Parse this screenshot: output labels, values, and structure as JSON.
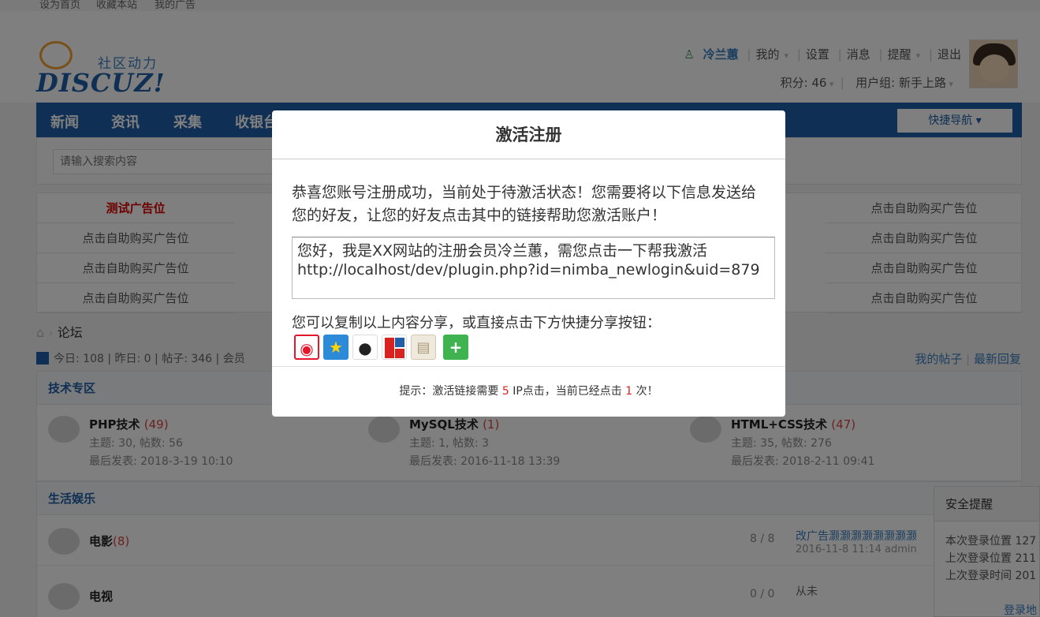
{
  "topbar": {
    "links": [
      "设为首页",
      "收藏本站",
      "我的广告"
    ]
  },
  "logo": {
    "slogan": "社区动力",
    "brand": "DISCUZ!"
  },
  "user": {
    "name": "冷兰蕙",
    "links": [
      "我的",
      "设置",
      "消息",
      "提醒",
      "退出"
    ],
    "points": "积分: 46",
    "group": "用户组: 新手上路"
  },
  "nav": {
    "items": [
      "新闻",
      "资讯",
      "采集",
      "收银台"
    ],
    "quick_nav": "快捷导航 ▾"
  },
  "search": {
    "placeholder": "请输入搜索内容"
  },
  "ads": {
    "test_ad": "测试广告位",
    "buy_ad": "点击自助购买广告位"
  },
  "breadcrumb": {
    "home_icon": "home-icon",
    "forum": "论坛"
  },
  "stats": {
    "text": "今日: 108 | 昨日: 0 | 帖子: 346 | 会员"
  },
  "mylinks": {
    "my_posts": "我的帖子",
    "latest": "最新回复"
  },
  "tech_section": {
    "title": "技术专区",
    "forums": [
      {
        "name": "PHP技术",
        "count": "(49)",
        "stats": "主题: 30, 帖数: 56",
        "last": "最后发表: 2018-3-19 10:10"
      },
      {
        "name": "MySQL技术",
        "count": "(1)",
        "stats": "主题: 1, 帖数: 3",
        "last": "最后发表: 2016-11-18 13:39"
      },
      {
        "name": "HTML+CSS技术",
        "count": "(47)",
        "stats": "主题: 35, 帖数: 276",
        "last": "最后发表: 2018-2-11 09:41"
      }
    ]
  },
  "life_section": {
    "title": "生活娱乐",
    "forums": [
      {
        "name": "电影",
        "count": "(8)",
        "ratio": "8 / 8",
        "last_title": "改广告灏灏灏灏灏灏灏灏",
        "last_meta": "2016-11-8 11:14 admin"
      },
      {
        "name": "电视",
        "count": "",
        "ratio": "0 / 0",
        "last_title": "从未",
        "last_meta": ""
      }
    ]
  },
  "security": {
    "title": "安全提醒",
    "lines": [
      "本次登录位置 127",
      "上次登录位置 211",
      "上次登录时间 201"
    ],
    "link": "登录地"
  },
  "modal": {
    "title": "激活注册",
    "message": "恭喜您账号注册成功，当前处于待激活状态！您需要将以下信息发送给您的好友，让您的好友点击其中的链接帮助您激活账户！",
    "share_text": "您好，我是XX网站的注册会员冷兰蕙，需您点击一下帮我激活\nhttp://localhost/dev/plugin.php?id=nimba_newlogin&uid=879",
    "copy_tip": "您可以复制以上内容分享，或直接点击下方快捷分享按钮：",
    "share_buttons": [
      {
        "name": "weibo-icon",
        "color": "#e6162d"
      },
      {
        "name": "qzone-icon",
        "color": "#2d8ad8"
      },
      {
        "name": "qq-icon",
        "color": "#1296db"
      },
      {
        "name": "renren-icon",
        "color": "#d9221f"
      },
      {
        "name": "copy-icon",
        "color": "#e8e0d4"
      },
      {
        "name": "more-icon",
        "color": "#3fb34f"
      }
    ],
    "footer_prefix": "提示：激活链接需要 ",
    "footer_need": "5",
    "footer_mid": " IP点击，当前已经点击 ",
    "footer_done": "1",
    "footer_suffix": " 次！"
  }
}
